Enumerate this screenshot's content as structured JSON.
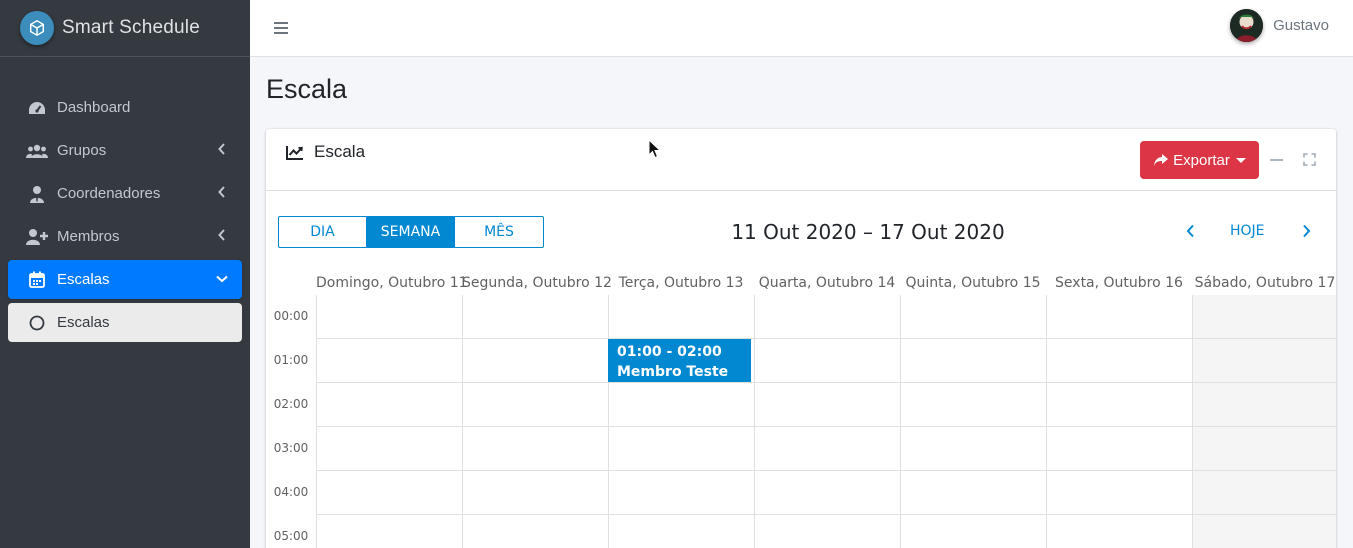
{
  "app": {
    "title": "Smart Schedule"
  },
  "sidebar": {
    "items": [
      {
        "label": "Dashboard",
        "icon": "dashboard-icon"
      },
      {
        "label": "Grupos",
        "icon": "users-icon"
      },
      {
        "label": "Coordenadores",
        "icon": "user-tie-icon"
      },
      {
        "label": "Membros",
        "icon": "user-plus-icon"
      },
      {
        "label": "Escalas",
        "icon": "calendar-icon",
        "active": true
      },
      {
        "label": "Escalas",
        "icon": "circle-icon",
        "sub_active": true
      }
    ]
  },
  "topbar": {
    "user_name": "Gustavo"
  },
  "page": {
    "title": "Escala"
  },
  "card": {
    "title": "Escala",
    "export_label": "Exportar"
  },
  "calendar": {
    "views": [
      "DIA",
      "SEMANA",
      "MÊS"
    ],
    "active_view": "SEMANA",
    "date_range": "11 Out 2020 – 17 Out 2020",
    "today_label": "HOJE",
    "days": [
      "Domingo, Outubro 11",
      "Segunda, Outubro 12",
      "Terça, Outubro 13",
      "Quarta, Outubro 14",
      "Quinta, Outubro 15",
      "Sexta, Outubro 16",
      "Sábado, Outubro 17"
    ],
    "hours": [
      "00:00",
      "01:00",
      "02:00",
      "03:00",
      "04:00",
      "05:00"
    ],
    "event": {
      "time": "01:00 - 02:00",
      "title": "Membro Teste",
      "day": "Terça, Outubro 13"
    },
    "colors": {
      "accent": "#0288d1",
      "danger": "#dc3545",
      "sidebar_active": "#007bff"
    }
  }
}
